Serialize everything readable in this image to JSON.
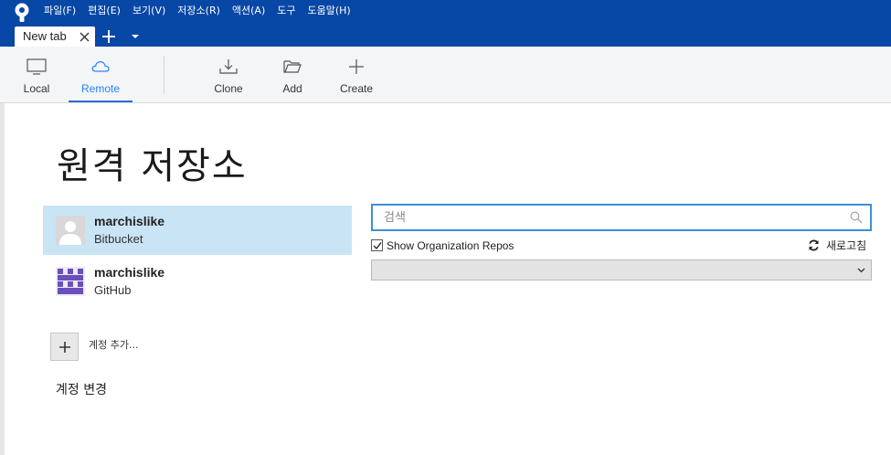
{
  "menu": [
    "파일(F)",
    "편집(E)",
    "보기(V)",
    "저장소(R)",
    "액션(A)",
    "도구",
    "도움말(H)"
  ],
  "tab": {
    "label": "New tab"
  },
  "toolbar": {
    "local": "Local",
    "remote": "Remote",
    "clone": "Clone",
    "add": "Add",
    "create": "Create"
  },
  "page": {
    "title": "원격 저장소"
  },
  "accounts": [
    {
      "name": "marchislike",
      "host": "Bitbucket",
      "selected": true
    },
    {
      "name": "marchislike",
      "host": "GitHub",
      "selected": false
    }
  ],
  "add_account_label": "계정 추가...",
  "switch_account_label": "계정 변경",
  "search": {
    "placeholder": "검색",
    "value": ""
  },
  "org_repos": {
    "label": "Show Organization Repos",
    "checked": true
  },
  "refresh_label": "새로고침",
  "repo_select": {
    "value": ""
  },
  "colors": {
    "titlebar": "#0747a6",
    "accent": "#2684ff",
    "selection": "#c9e4f5",
    "github_avatar": "#6b4fbb"
  }
}
